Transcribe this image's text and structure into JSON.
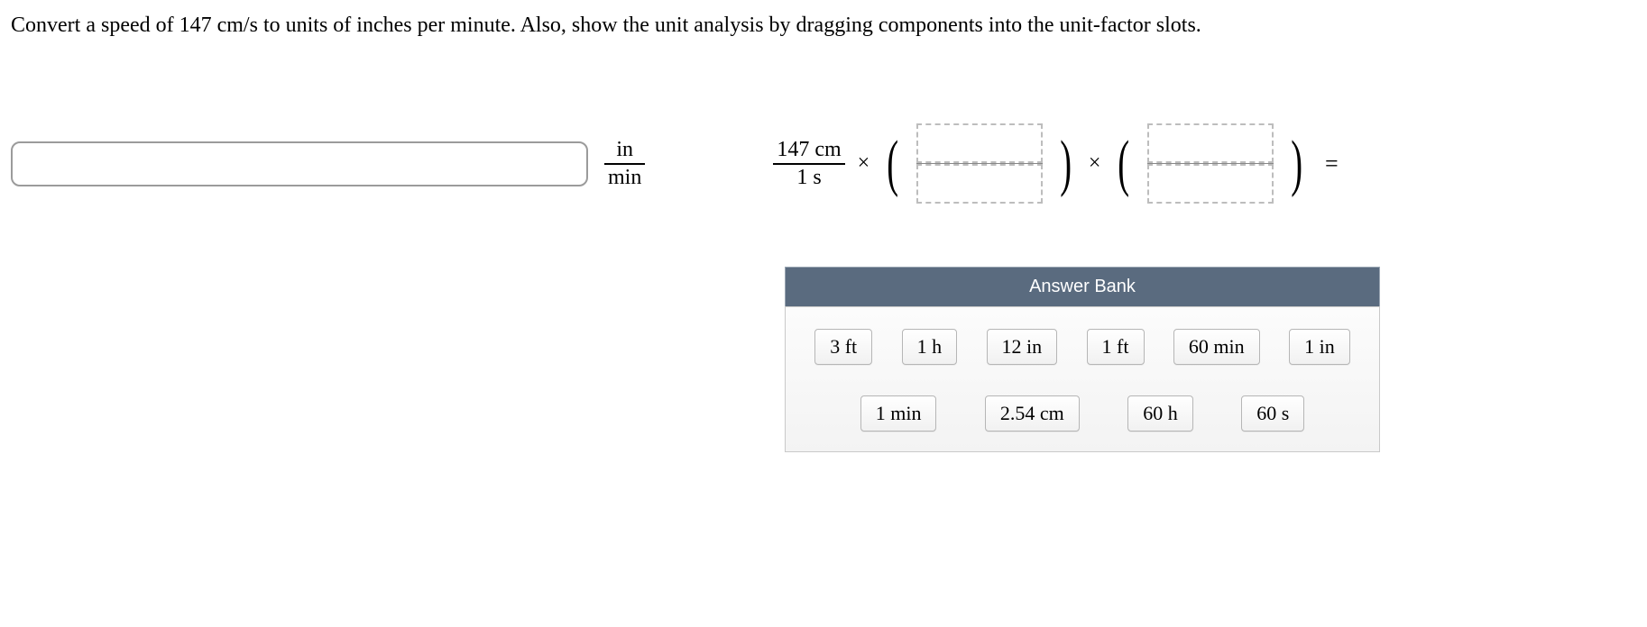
{
  "question": "Convert a speed of 147 cm/s to units of inches per minute. Also, show the unit analysis by dragging components into the unit-factor slots.",
  "answer_unit": {
    "num": "in",
    "den": "min"
  },
  "given": {
    "num": "147 cm",
    "den": "1 s"
  },
  "operators": {
    "times": "×",
    "equals": "="
  },
  "parens": {
    "open": "(",
    "close": ")"
  },
  "bank": {
    "title": "Answer Bank",
    "row1": [
      "3 ft",
      "1 h",
      "12 in",
      "1 ft",
      "60 min",
      "1 in"
    ],
    "row2": [
      "1 min",
      "2.54 cm",
      "60 h",
      "60 s"
    ]
  }
}
